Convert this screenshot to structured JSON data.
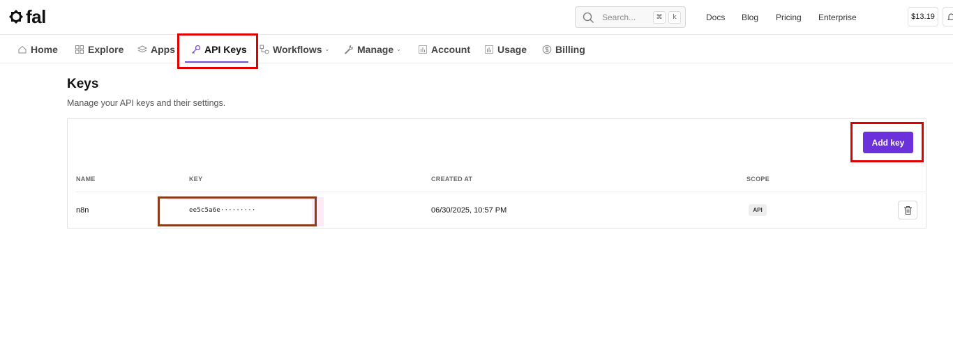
{
  "brand": {
    "name": "fal"
  },
  "search": {
    "placeholder": "Search...",
    "shortcut_mod": "⌘",
    "shortcut_key": "k"
  },
  "top_links": [
    "Docs",
    "Blog",
    "Pricing",
    "Enterprise"
  ],
  "credit": "$13.19",
  "nav": {
    "items": [
      {
        "label": "Home",
        "icon": "home-icon"
      },
      {
        "label": "Explore",
        "icon": "grid-icon"
      },
      {
        "label": "Apps",
        "icon": "layers-icon"
      },
      {
        "label": "API Keys",
        "icon": "key-icon",
        "active": true
      },
      {
        "label": "Workflows",
        "icon": "workflow-icon",
        "dropdown": true
      },
      {
        "label": "Manage",
        "icon": "wrench-icon",
        "dropdown": true
      },
      {
        "label": "Account",
        "icon": "bar-chart-icon"
      },
      {
        "label": "Usage",
        "icon": "bar-chart-icon"
      },
      {
        "label": "Billing",
        "icon": "dollar-icon"
      }
    ],
    "caret": "⌄"
  },
  "page": {
    "title": "Keys",
    "subtitle": "Manage your API keys and their settings."
  },
  "add_button": "Add key",
  "table": {
    "headers": [
      "NAME",
      "KEY",
      "CREATED AT",
      "SCOPE"
    ],
    "rows": [
      {
        "name": "n8n",
        "key": "ee5c5a6e·········",
        "created_at": "06/30/2025, 10:57 PM",
        "scope": "API"
      }
    ]
  },
  "colors": {
    "accent": "#6b32dc",
    "highlight": "#e00000"
  }
}
